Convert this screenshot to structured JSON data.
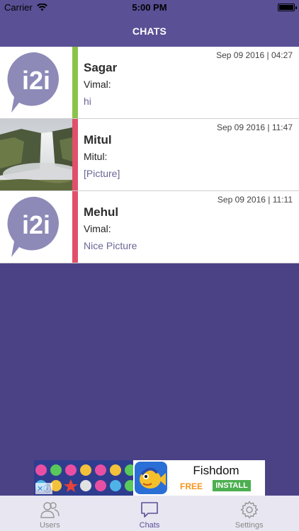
{
  "status_bar": {
    "carrier": "Carrier",
    "time": "5:00 PM"
  },
  "nav": {
    "title": "CHATS"
  },
  "colors": {
    "brand": "#5a5095",
    "background": "#4b4286",
    "online": "#8bc34a",
    "offline": "#e0506a"
  },
  "chats": [
    {
      "name": "Sagar",
      "sender": "Vimal:",
      "preview": "hi",
      "timestamp": "Sep 09 2016 | 04:27",
      "avatar": "i2i",
      "status": "online"
    },
    {
      "name": "Mitul",
      "sender": "Mitul:",
      "preview": "[Picture]",
      "timestamp": "Sep 09 2016 | 11:47",
      "avatar": "waterfall-photo",
      "status": "offline"
    },
    {
      "name": "Mehul",
      "sender": "Vimal:",
      "preview": "Nice Picture",
      "timestamp": "Sep 09 2016 | 11:11",
      "avatar": "i2i",
      "status": "offline"
    }
  ],
  "ad": {
    "title": "Fishdom",
    "free_label": "FREE",
    "install_label": "INSTALL"
  },
  "tabs": [
    {
      "label": "Users",
      "icon": "users-icon",
      "active": false
    },
    {
      "label": "Chats",
      "icon": "chat-icon",
      "active": true
    },
    {
      "label": "Settings",
      "icon": "gear-icon",
      "active": false
    }
  ]
}
